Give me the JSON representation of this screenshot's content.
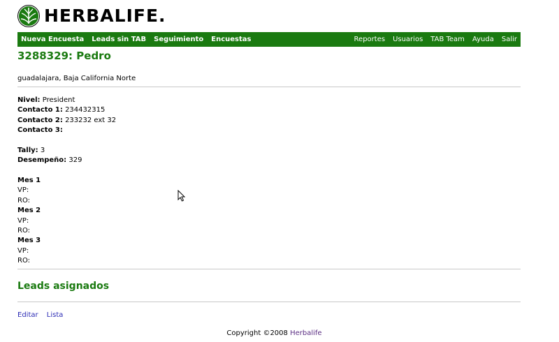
{
  "brand": {
    "name": "HERBALIFE.",
    "color": "#1a7a10"
  },
  "nav": {
    "left": [
      "Nueva Encuesta",
      "Leads sin TAB",
      "Seguimiento",
      "Encuestas"
    ],
    "right": [
      "Reportes",
      "Usuarios",
      "TAB Team",
      "Ayuda",
      "Salir"
    ]
  },
  "header": {
    "title": "3288329: Pedro",
    "location": "guadalajara, Baja California Norte"
  },
  "details": {
    "nivel_label": "Nivel:",
    "nivel_value": "President",
    "contacto1_label": "Contacto 1:",
    "contacto1_value": "234432315",
    "contacto2_label": "Contacto 2:",
    "contacto2_value": "233232 ext 32",
    "contacto3_label": "Contacto 3:",
    "contacto3_value": "",
    "tally_label": "Tally:",
    "tally_value": "3",
    "desempeno_label": "Desempeño:",
    "desempeno_value": "329"
  },
  "months": [
    {
      "title": "Mes 1",
      "vp_label": "VP:",
      "vp_value": "",
      "ro_label": "RO:",
      "ro_value": ""
    },
    {
      "title": "Mes 2",
      "vp_label": "VP:",
      "vp_value": "",
      "ro_label": "RO:",
      "ro_value": ""
    },
    {
      "title": "Mes 3",
      "vp_label": "VP:",
      "vp_value": "",
      "ro_label": "RO:",
      "ro_value": ""
    }
  ],
  "leads_section": {
    "title": "Leads asignados"
  },
  "actions": {
    "edit_label": "Editar",
    "list_label": "Lista"
  },
  "footer": {
    "copyright_text": "Copyright ©2008",
    "link_text": "Herbalife"
  },
  "icons": {
    "logo": "herbalife-leaf-logo-icon",
    "cursor": "mouse-pointer-icon"
  }
}
